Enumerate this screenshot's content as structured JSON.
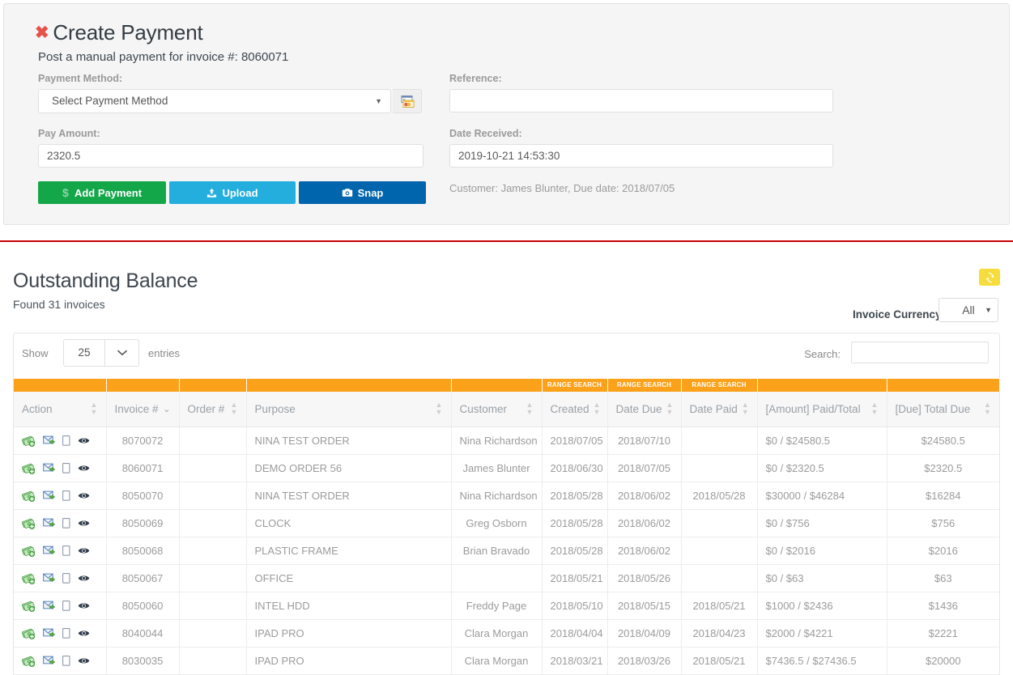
{
  "payment_panel": {
    "close_icon": "close-x-icon",
    "title": "Create Payment",
    "subtitle": "Post a manual payment for invoice #: 8060071",
    "payment_method_label": "Payment Method:",
    "payment_method_value": "Select Payment Method",
    "card_button_icon": "credit-card-icon",
    "pay_amount_label": "Pay Amount:",
    "pay_amount_value": "2320.5",
    "reference_label": "Reference:",
    "reference_value": "",
    "reference_placeholder": "",
    "date_received_label": "Date Received:",
    "date_received_value": "2019-10-21 14:53:30",
    "customer_note": "Customer: James Blunter, Due date: 2018/07/05",
    "buttons": {
      "add_payment": "Add Payment",
      "upload": "Upload",
      "snap": "Snap"
    },
    "colors": {
      "add_payment": "#14a74a",
      "upload": "#23aede",
      "snap": "#0065ac",
      "close_x": "#e8504a"
    }
  },
  "outstanding": {
    "title": "Outstanding Balance",
    "found": "Found 31 invoices",
    "refresh_icon": "refresh-icon",
    "refresh_color": "#f6dc3c",
    "currency_label": "Invoice Currency:",
    "currency_value": "All"
  },
  "datatable": {
    "show_label": "Show",
    "page_length": "25",
    "entries_label": "entries",
    "search_label": "Search:",
    "search_value": "",
    "search_placeholder": "",
    "range_search_tag": "RANGE SEARCH",
    "header_color": "#fca11a",
    "columns": [
      {
        "key": "action",
        "label": "Action",
        "range_search": false,
        "sorted": null,
        "align": "left"
      },
      {
        "key": "invoice",
        "label": "Invoice #",
        "range_search": false,
        "sorted": "desc",
        "align": "center"
      },
      {
        "key": "order",
        "label": "Order #",
        "range_search": false,
        "sorted": null,
        "align": "center"
      },
      {
        "key": "purpose",
        "label": "Purpose",
        "range_search": false,
        "sorted": null,
        "align": "left"
      },
      {
        "key": "customer",
        "label": "Customer",
        "range_search": false,
        "sorted": null,
        "align": "center"
      },
      {
        "key": "created",
        "label": "Created",
        "range_search": true,
        "sorted": null,
        "align": "center"
      },
      {
        "key": "datedue",
        "label": "Date Due",
        "range_search": true,
        "sorted": null,
        "align": "center"
      },
      {
        "key": "datepaid",
        "label": "Date Paid",
        "range_search": true,
        "sorted": null,
        "align": "center"
      },
      {
        "key": "amount",
        "label": "[Amount] Paid/Total",
        "range_search": false,
        "sorted": null,
        "align": "left"
      },
      {
        "key": "due",
        "label": "[Due] Total Due",
        "range_search": false,
        "sorted": null,
        "align": "center"
      }
    ],
    "row_icons": [
      "add-payment-money-icon",
      "send-email-icon",
      "document-icon",
      "view-eye-icon"
    ],
    "rows": [
      {
        "invoice": "8070072",
        "order": "",
        "purpose": "NINA TEST ORDER",
        "customer": "Nina Richardson",
        "created": "2018/07/05",
        "datedue": "2018/07/10",
        "datepaid": "",
        "amount": "$0 / $24580.5",
        "due": "$24580.5"
      },
      {
        "invoice": "8060071",
        "order": "",
        "purpose": "DEMO ORDER 56",
        "customer": "James Blunter",
        "created": "2018/06/30",
        "datedue": "2018/07/05",
        "datepaid": "",
        "amount": "$0 / $2320.5",
        "due": "$2320.5"
      },
      {
        "invoice": "8050070",
        "order": "",
        "purpose": "NINA TEST ORDER",
        "customer": "Nina Richardson",
        "created": "2018/05/28",
        "datedue": "2018/06/02",
        "datepaid": "2018/05/28",
        "amount": "$30000 / $46284",
        "due": "$16284"
      },
      {
        "invoice": "8050069",
        "order": "",
        "purpose": "CLOCK",
        "customer": "Greg Osborn",
        "created": "2018/05/28",
        "datedue": "2018/06/02",
        "datepaid": "",
        "amount": "$0 / $756",
        "due": "$756"
      },
      {
        "invoice": "8050068",
        "order": "",
        "purpose": "PLASTIC FRAME",
        "customer": "Brian Bravado",
        "created": "2018/05/28",
        "datedue": "2018/06/02",
        "datepaid": "",
        "amount": "$0 / $2016",
        "due": "$2016"
      },
      {
        "invoice": "8050067",
        "order": "",
        "purpose": "OFFICE",
        "customer": "",
        "created": "2018/05/21",
        "datedue": "2018/05/26",
        "datepaid": "",
        "amount": "$0 / $63",
        "due": "$63"
      },
      {
        "invoice": "8050060",
        "order": "",
        "purpose": "INTEL HDD",
        "customer": "Freddy Page",
        "created": "2018/05/10",
        "datedue": "2018/05/15",
        "datepaid": "2018/05/21",
        "amount": "$1000 / $2436",
        "due": "$1436"
      },
      {
        "invoice": "8040044",
        "order": "",
        "purpose": "IPAD PRO",
        "customer": "Clara Morgan",
        "created": "2018/04/04",
        "datedue": "2018/04/09",
        "datepaid": "2018/04/23",
        "amount": "$2000 / $4221",
        "due": "$2221"
      },
      {
        "invoice": "8030035",
        "order": "",
        "purpose": "IPAD PRO",
        "customer": "Clara Morgan",
        "created": "2018/03/21",
        "datedue": "2018/03/26",
        "datepaid": "2018/05/21",
        "amount": "$7436.5 / $27436.5",
        "due": "$20000"
      }
    ]
  }
}
